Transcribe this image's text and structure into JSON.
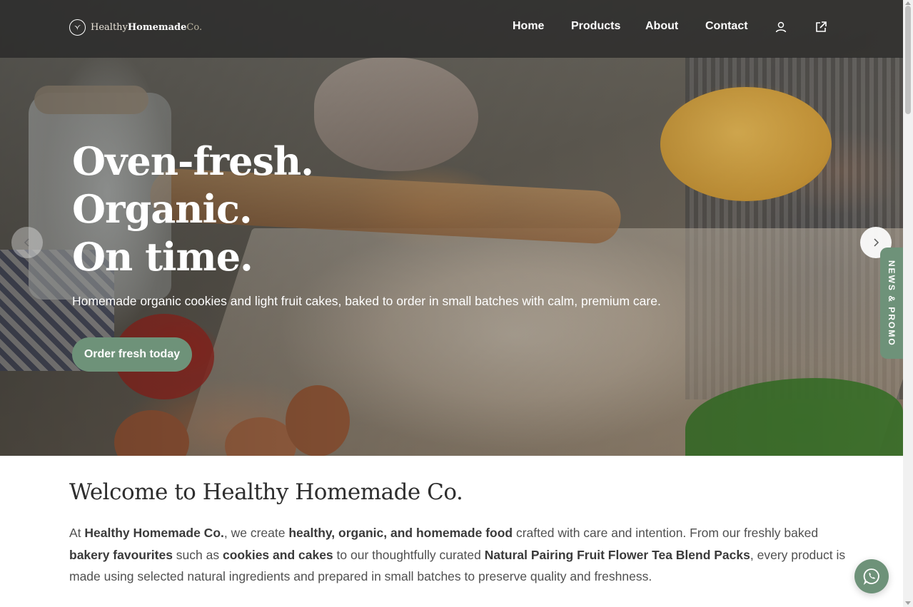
{
  "brand": {
    "name_prefix": "Healthy",
    "name_main": "Homemade",
    "name_suffix": "Co.",
    "logo_icon": "leaf-circle-icon"
  },
  "nav": {
    "links": [
      "Home",
      "Products",
      "About",
      "Contact"
    ],
    "account_icon": "user-icon",
    "external_icon": "external-link-icon"
  },
  "hero": {
    "title_lines": [
      "Oven-fresh.",
      "Organic.",
      "On time."
    ],
    "subtitle": "Homemade organic cookies and light fruit cakes, baked to order in small batches with calm, premium care.",
    "cta_label": "Order fresh today",
    "prev_icon": "chevron-left-icon",
    "next_icon": "chevron-right-icon"
  },
  "side_tab": {
    "label": "NEWS & PROMO"
  },
  "welcome": {
    "title": "Welcome to Healthy Homemade Co.",
    "paragraph": [
      {
        "t": "At ",
        "b": false
      },
      {
        "t": "Healthy Homemade Co.",
        "b": true
      },
      {
        "t": ", we create ",
        "b": false
      },
      {
        "t": "healthy, organic, and homemade food",
        "b": true
      },
      {
        "t": " crafted with care and intention. From our freshly baked ",
        "b": false
      },
      {
        "t": "bakery favourites",
        "b": true
      },
      {
        "t": " such as ",
        "b": false
      },
      {
        "t": "cookies and cakes",
        "b": true
      },
      {
        "t": " to our thoughtfully curated ",
        "b": false
      },
      {
        "t": "Natural Pairing Fruit Flower Tea Blend Packs",
        "b": true
      },
      {
        "t": ", every product is made using selected natural ingredients and prepared in small batches to preserve quality and freshness.",
        "b": false
      }
    ]
  },
  "chat": {
    "icon": "whatsapp-icon"
  },
  "colors": {
    "accent": "#6e9279",
    "nav_bg": "#282828",
    "heading": "#2e2e2e",
    "body_text": "#505050"
  }
}
